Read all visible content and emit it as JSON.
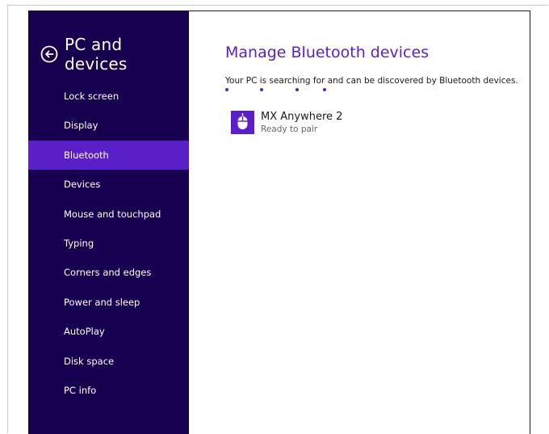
{
  "sidebar": {
    "title": "PC and devices",
    "back_icon": "back-arrow-circle-icon",
    "selected": "Bluetooth",
    "items": [
      {
        "label": "Lock screen"
      },
      {
        "label": "Display"
      },
      {
        "label": "Bluetooth"
      },
      {
        "label": "Devices"
      },
      {
        "label": "Mouse and touchpad"
      },
      {
        "label": "Typing"
      },
      {
        "label": "Corners and edges"
      },
      {
        "label": "Power and sleep"
      },
      {
        "label": "AutoPlay"
      },
      {
        "label": "Disk space"
      },
      {
        "label": "PC info"
      }
    ]
  },
  "main": {
    "title": "Manage Bluetooth devices",
    "status": "Your PC is searching for and can be discovered by Bluetooth devices.",
    "devices": [
      {
        "name": "MX Anywhere 2",
        "status": "Ready to pair",
        "icon": "mouse-icon"
      }
    ]
  },
  "colors": {
    "sidebar_bg": "#180050",
    "accent": "#5a1fc6",
    "text": "#1a1a1a",
    "subtext": "#666666"
  }
}
